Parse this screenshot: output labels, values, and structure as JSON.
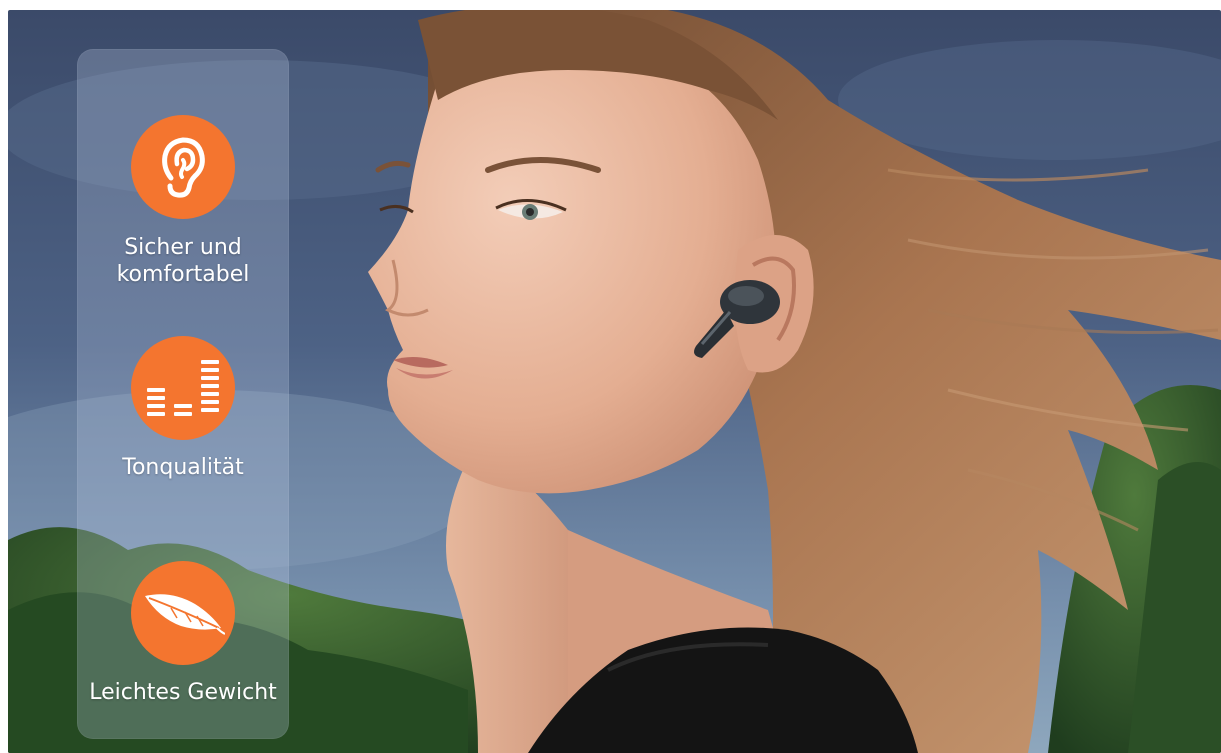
{
  "features": [
    {
      "label": "Sicher und\nkomfortabel",
      "icon": "ear-icon"
    },
    {
      "label": "Tonqualität",
      "icon": "equalizer-icon"
    },
    {
      "label": "Leichtes Gewicht",
      "icon": "feather-icon"
    }
  ],
  "colors": {
    "accent": "#f4752f",
    "sky_top": "#3f4f70",
    "sky_bottom": "#7a93b0",
    "foliage": "#2f5a2a",
    "hair": "#9c6a45",
    "skin": "#e8b79c",
    "earbud": "#2c3136"
  }
}
